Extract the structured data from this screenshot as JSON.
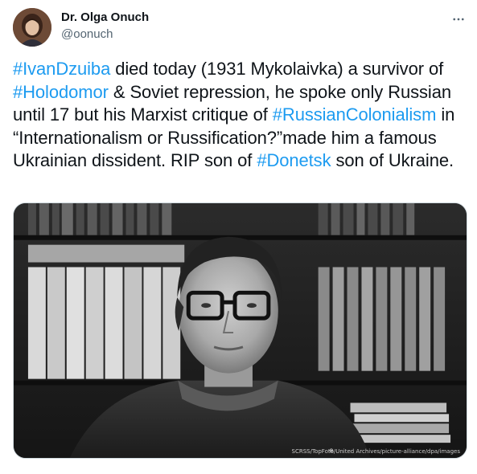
{
  "author": {
    "display_name": "Dr. Olga Onuch",
    "handle": "@oonuch"
  },
  "more_icon": "more-horizontal-icon",
  "tweet": {
    "segments": [
      {
        "text": "#IvanDzuiba",
        "type": "hashtag"
      },
      {
        "text": " died today (1931 Mykolaivka) a survivor of ",
        "type": "text"
      },
      {
        "text": "#Holodomor",
        "type": "hashtag"
      },
      {
        "text": " & Soviet repression, he spoke only Russian until 17 but his Marxist critique of ",
        "type": "text"
      },
      {
        "text": "#RussianColonialism",
        "type": "hashtag"
      },
      {
        "text": " in “Internationalism or Russification?”made him a famous Ukrainian dissident. RIP son of ",
        "type": "text"
      },
      {
        "text": "#Donetsk",
        "type": "hashtag"
      },
      {
        "text": " son of Ukraine.",
        "type": "text"
      }
    ]
  },
  "media": {
    "credit": "SCRSS/TopFoto/United Archives/picture-alliance/dpa/images",
    "style": "black-and-white photo"
  },
  "colors": {
    "link": "#1d9bf0",
    "text": "#0f1419",
    "secondary": "#536471",
    "border": "#cfd9de"
  }
}
